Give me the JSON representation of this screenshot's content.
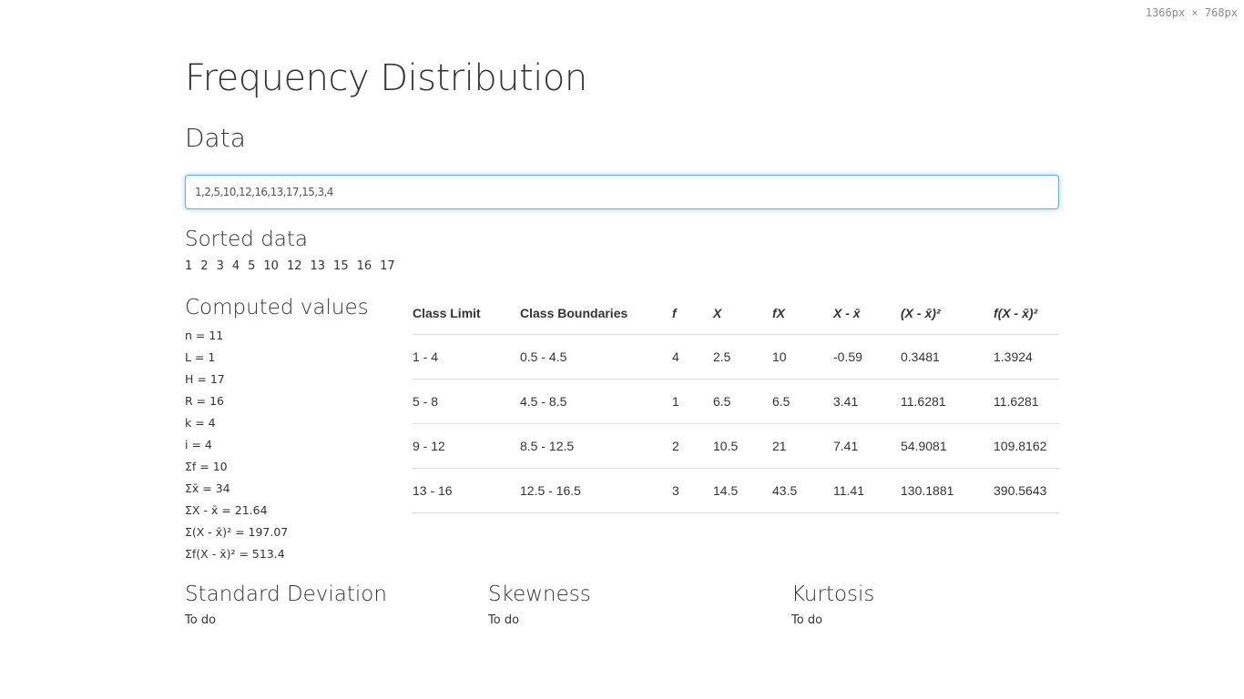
{
  "viewport_badge": "1366px × 768px",
  "page": {
    "title": "Frequency Distribution"
  },
  "data_section": {
    "heading": "Data",
    "input_value": "1,2,5,10,12,16,13,17,15,3,4"
  },
  "sorted_section": {
    "heading": "Sorted data",
    "values": [
      "1",
      "2",
      "3",
      "4",
      "5",
      "10",
      "12",
      "13",
      "15",
      "16",
      "17"
    ]
  },
  "computed_section": {
    "heading": "Computed values",
    "items": [
      {
        "label": "n",
        "value": "11"
      },
      {
        "label": "L",
        "value": "1"
      },
      {
        "label": "H",
        "value": "17"
      },
      {
        "label": "R",
        "value": "16"
      },
      {
        "label": "k",
        "value": "4"
      },
      {
        "label": "i",
        "value": "4"
      },
      {
        "label": "Σf",
        "value": "10"
      },
      {
        "label": "Σx̄",
        "value": "34"
      },
      {
        "label": "ΣX - x̄",
        "value": "21.64"
      },
      {
        "label": "Σ(X - x̄)²",
        "value": "197.07"
      },
      {
        "label": "Σf(X - x̄)²",
        "value": "513.4"
      }
    ]
  },
  "table": {
    "headers": [
      "Class Limit",
      "Class Boundaries",
      "f",
      "X",
      "fX",
      "X - x̄",
      "(X - x̄)²",
      "f(X - x̄)²"
    ],
    "rows": [
      [
        "1 - 4",
        "0.5 - 4.5",
        "4",
        "2.5",
        "10",
        "-0.59",
        "0.3481",
        "1.3924"
      ],
      [
        "5 - 8",
        "4.5 - 8.5",
        "1",
        "6.5",
        "6.5",
        "3.41",
        "11.6281",
        "11.6281"
      ],
      [
        "9 - 12",
        "8.5 - 12.5",
        "2",
        "10.5",
        "21",
        "7.41",
        "54.9081",
        "109.8162"
      ],
      [
        "13 - 16",
        "12.5 - 16.5",
        "3",
        "14.5",
        "43.5",
        "11.41",
        "130.1881",
        "390.5643"
      ]
    ]
  },
  "bottom": [
    {
      "heading": "Standard Deviation",
      "value": "To do"
    },
    {
      "heading": "Skewness",
      "value": "To do"
    },
    {
      "heading": "Kurtosis",
      "value": "To do"
    }
  ]
}
